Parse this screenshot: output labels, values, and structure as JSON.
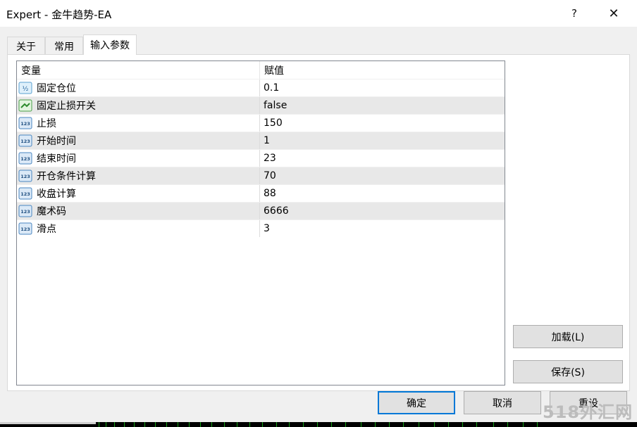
{
  "window": {
    "title": "Expert - 金牛趋势-EA",
    "help_glyph": "?",
    "close_glyph": "✕"
  },
  "tabs": [
    {
      "label": "关于"
    },
    {
      "label": "常用"
    },
    {
      "label": "输入参数",
      "active": true
    }
  ],
  "grid": {
    "headers": {
      "variable": "变量",
      "value": "赋值"
    },
    "rows": [
      {
        "icon": "fraction-icon",
        "name": "固定仓位",
        "value": "0.1"
      },
      {
        "icon": "bool-toggle-icon",
        "name": "固定止损开关",
        "value": "false"
      },
      {
        "icon": "integer-123-icon",
        "name": "止损",
        "value": "150"
      },
      {
        "icon": "integer-123-icon",
        "name": "开始时间",
        "value": "1"
      },
      {
        "icon": "integer-123-icon",
        "name": "结束时间",
        "value": "23"
      },
      {
        "icon": "integer-123-icon",
        "name": "开仓条件计算",
        "value": "70"
      },
      {
        "icon": "integer-123-icon",
        "name": "收盘计算",
        "value": "88"
      },
      {
        "icon": "integer-123-icon",
        "name": "魔术码",
        "value": "6666"
      },
      {
        "icon": "integer-123-icon",
        "name": "滑点",
        "value": "3"
      }
    ]
  },
  "buttons": {
    "load": "加载(L)",
    "save": "保存(S)",
    "ok": "确定",
    "cancel": "取消",
    "reset": "重设"
  },
  "watermark": "518外汇网",
  "colors": {
    "accent_focus": "#0078d7",
    "row_alt": "#e8e8e8"
  }
}
